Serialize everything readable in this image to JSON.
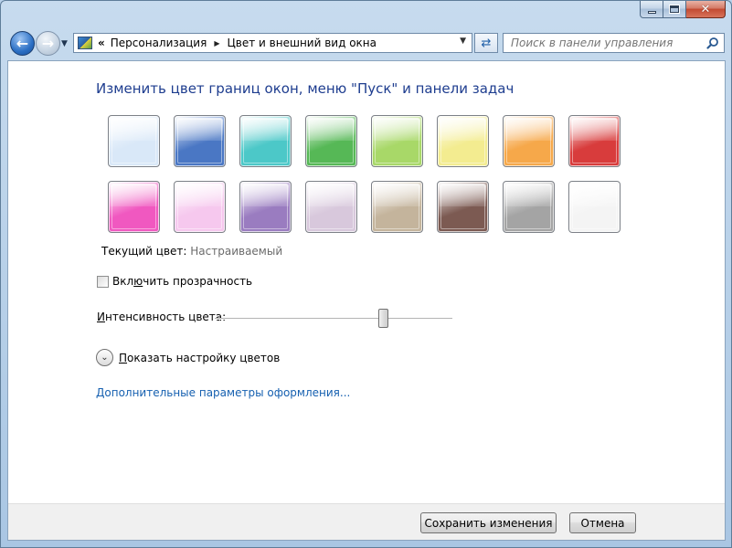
{
  "window": {
    "buttons": {
      "minimize": "minimize",
      "maximize": "maximize",
      "close": "✕"
    }
  },
  "nav": {
    "breadcrumb": [
      "Персонализация",
      "Цвет и внешний вид окна"
    ],
    "overflow": "«",
    "search": {
      "placeholder": "Поиск в панели управления"
    }
  },
  "main": {
    "heading": "Изменить цвет границ окон, меню \"Пуск\" и панели задач",
    "swatches": [
      {
        "name": "sky",
        "color": "#d9e8f8"
      },
      {
        "name": "twilight",
        "color": "#4a77c4"
      },
      {
        "name": "sea",
        "color": "#4cc8c8"
      },
      {
        "name": "leaf",
        "color": "#56b856"
      },
      {
        "name": "lime",
        "color": "#a8d868"
      },
      {
        "name": "lemon",
        "color": "#f3ec90"
      },
      {
        "name": "pumpkin",
        "color": "#f6a84a"
      },
      {
        "name": "ruby",
        "color": "#d83c3c"
      },
      {
        "name": "fuchsia",
        "color": "#f058c0"
      },
      {
        "name": "blush",
        "color": "#f6c8ee"
      },
      {
        "name": "violet",
        "color": "#9a7cc0"
      },
      {
        "name": "lavender",
        "color": "#d8c8dc"
      },
      {
        "name": "taupe",
        "color": "#c4b49c"
      },
      {
        "name": "chocolate",
        "color": "#7c5a52"
      },
      {
        "name": "slate",
        "color": "#a4a4a4"
      },
      {
        "name": "frost",
        "color": "#f4f4f4"
      }
    ],
    "current_color_label": "Текущий цвет:",
    "current_color_value": "Настраиваемый",
    "transparency": {
      "pre": "Вкл",
      "accel": "ю",
      "post": "чить прозрачность",
      "checked": false
    },
    "intensity": {
      "accel": "И",
      "rest": "нтенсивность цвета:",
      "value_percent": 72
    },
    "show_mixer": {
      "accel": "П",
      "rest": "оказать настройку цветов"
    },
    "advanced_link": "Дополнительные параметры оформления..."
  },
  "footer": {
    "save": "Сохранить изменения",
    "cancel": "Отмена"
  }
}
